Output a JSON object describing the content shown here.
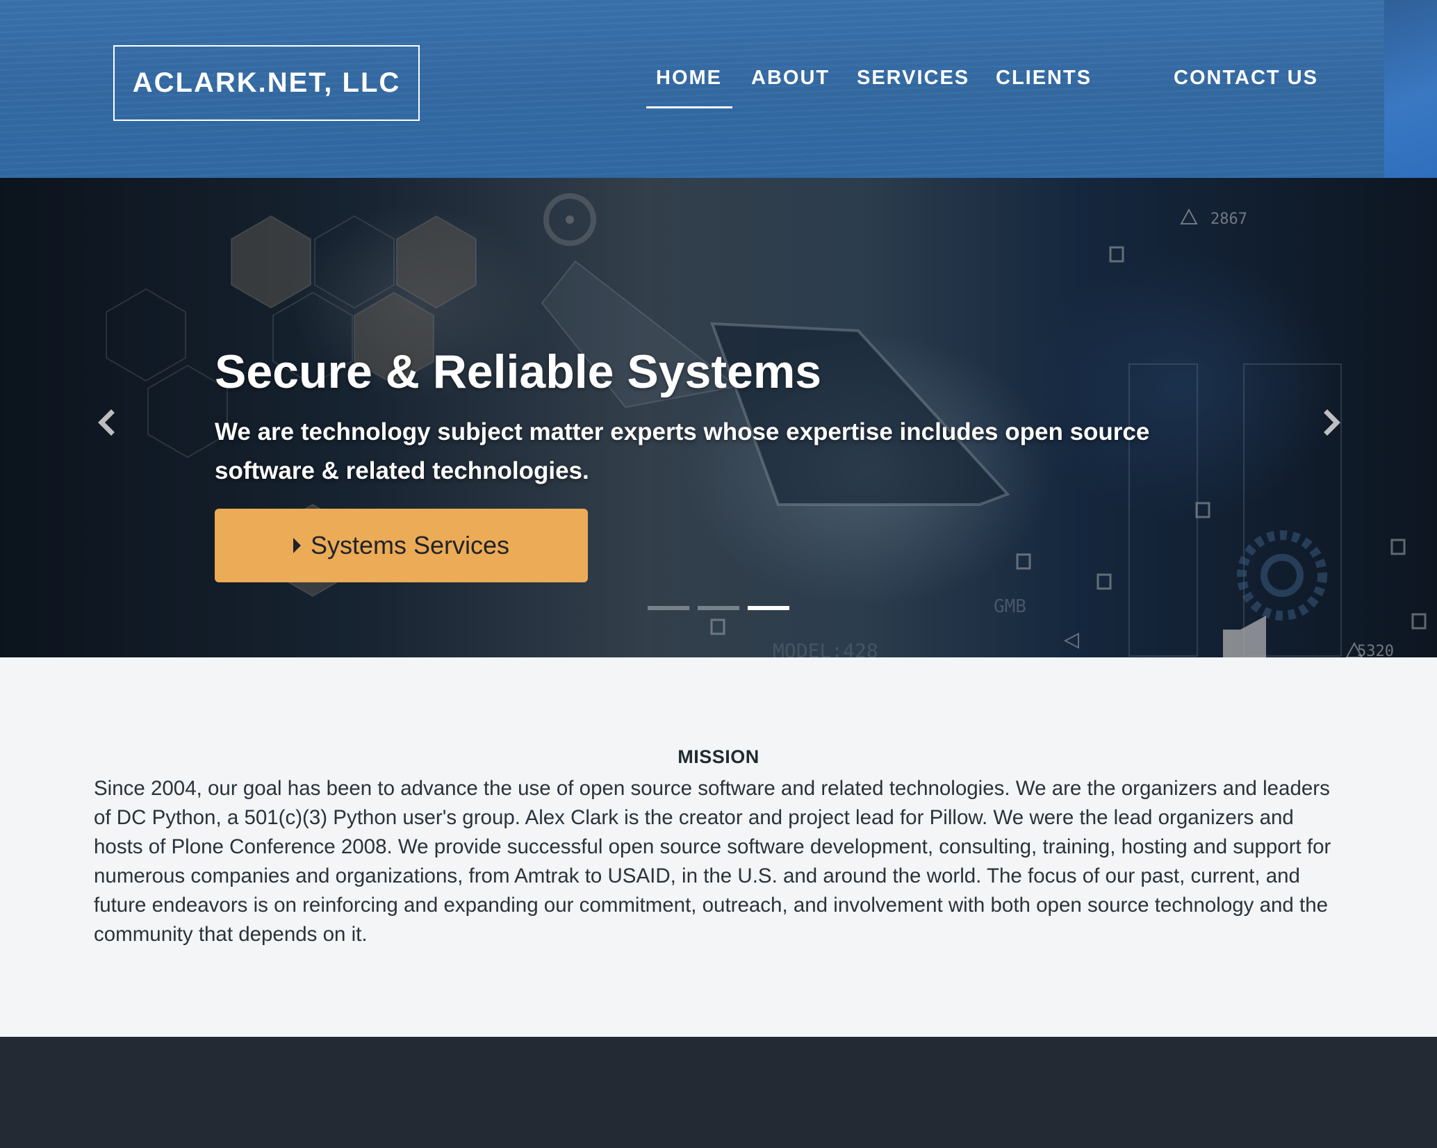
{
  "header": {
    "brand": "ACLARK.NET, LLC",
    "nav": [
      {
        "label": "HOME",
        "active": true
      },
      {
        "label": "ABOUT",
        "active": false
      },
      {
        "label": "SERVICES",
        "active": false
      },
      {
        "label": "CLIENTS",
        "active": false
      },
      {
        "label": "CONTACT US",
        "active": false
      }
    ]
  },
  "hero": {
    "title": "Secure & Reliable Systems",
    "subtitle": "We are technology subject matter experts whose expertise includes open source software & related technologies.",
    "button_label": "Systems Services",
    "button_icon": "caret-right-icon",
    "slides_count": 3,
    "active_slide": 3,
    "overlay_texts": [
      "2867",
      "GMB",
      "MODEL:428",
      "5320"
    ]
  },
  "mission": {
    "heading": "MISSION",
    "text": "Since 2004, our goal has been to advance the use of open source software and related technologies. We are the organizers and leaders of DC Python, a 501(c)(3) Python user's group. Alex Clark is the creator and project lead for Pillow. We were the lead organizers and hosts of Plone Conference 2008. We provide successful open source software development, consulting, training, hosting and support for numerous companies and organizations, from Amtrak to USAID, in the U.S. and around the world. The focus of our past, current, and future endeavors is on reinforcing and expanding our commitment, outreach, and involvement with both open source technology and the community that depends on it."
  },
  "colors": {
    "header_blue": "#346aa3",
    "button_orange": "#ecab56",
    "mission_bg": "#f3f5f6",
    "footer_bg": "#232a33"
  }
}
